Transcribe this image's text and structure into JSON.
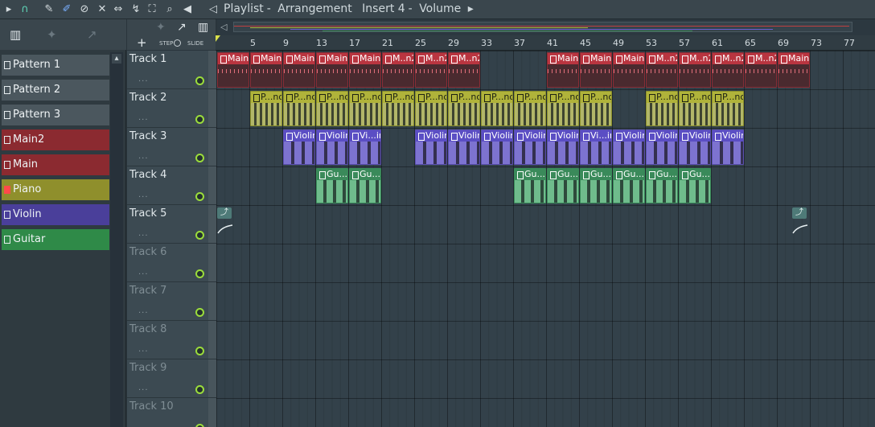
{
  "toolbar": {
    "breadcrumb": [
      "Playlist",
      "Arrangement",
      "Insert 4",
      "Volume"
    ],
    "separator": "-",
    "dropdown_arrow": "▸"
  },
  "left_panel": {
    "patterns": [
      {
        "label": "Pattern 1",
        "color": "#4b575e"
      },
      {
        "label": "Pattern 2",
        "color": "#4b575e"
      },
      {
        "label": "Pattern 3",
        "color": "#4b575e"
      },
      {
        "label": "Main2",
        "color": "#8b2a30"
      },
      {
        "label": "Main",
        "color": "#8b2a30"
      },
      {
        "label": "Piano",
        "color": "#8f8f2c"
      },
      {
        "label": "Violin",
        "color": "#4a3f9a"
      },
      {
        "label": "Guitar",
        "color": "#2f8a48"
      }
    ]
  },
  "header": {
    "add_label": "+",
    "step_label": "STEP",
    "slide_label": "SLIDE"
  },
  "ruler": {
    "bars": [
      "5",
      "9",
      "13",
      "17",
      "21",
      "25",
      "29",
      "33",
      "37",
      "41",
      "45",
      "49",
      "53",
      "57",
      "61",
      "65",
      "69",
      "73",
      "77"
    ]
  },
  "tracks": [
    {
      "name": "Track 1",
      "dim": false
    },
    {
      "name": "Track 2",
      "dim": false
    },
    {
      "name": "Track 3",
      "dim": false
    },
    {
      "name": "Track 4",
      "dim": false
    },
    {
      "name": "Track 5",
      "dim": false
    },
    {
      "name": "Track 6",
      "dim": true
    },
    {
      "name": "Track 7",
      "dim": true
    },
    {
      "name": "Track 8",
      "dim": true
    },
    {
      "name": "Track 9",
      "dim": true
    },
    {
      "name": "Track 10",
      "dim": true
    }
  ],
  "clips": {
    "track1": [
      "Main",
      "Main",
      "Main",
      "Main",
      "Main",
      "M..n2",
      "M..n2",
      "M..n2",
      "Main",
      "Main",
      "Main",
      "M..n2",
      "M..n2",
      "M..n2",
      "M..n2",
      "Main"
    ],
    "track2": [
      "P...no",
      "P...no",
      "P...no",
      "P...no",
      "P...no",
      "P...no",
      "P...no",
      "P...no",
      "P...no",
      "P...no",
      "P...no",
      "P...no",
      "P...no",
      "P...no"
    ],
    "track3": [
      "Violin",
      "Violin",
      "Vi...in",
      "Violin",
      "Violin",
      "Violin",
      "Violin",
      "Violin",
      "Vi...in",
      "Violin",
      "Violin",
      "Violin",
      "Violin"
    ],
    "track4": [
      "Gu...r",
      "Gu...r",
      "Gu...r",
      "Gu...r",
      "Gu...r",
      "Gu...r",
      "Gu...r",
      "Gu...r"
    ]
  },
  "track_dots": "...",
  "colors": {
    "main": "#b93540",
    "piano": "#b0b33a",
    "violin": "#5b4ec4",
    "guitar": "#3a8a5a",
    "led": "#9bdd3b"
  }
}
